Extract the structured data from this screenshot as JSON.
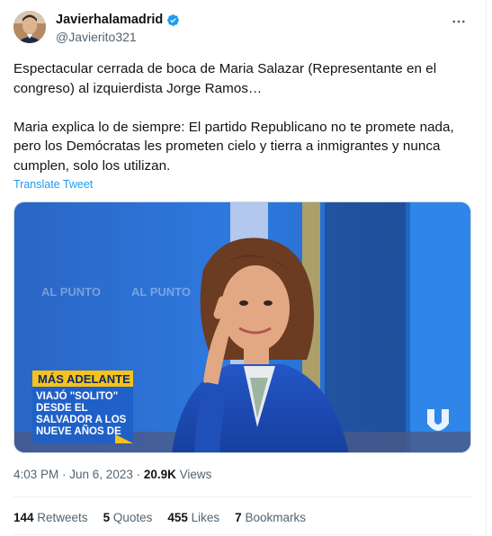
{
  "author": {
    "display_name": "Javierhalamadrid",
    "handle": "@Javierito321"
  },
  "tweet": {
    "text": "Espectacular cerrada de boca de Maria Salazar (Representante en el congreso) al izquierdista Jorge Ramos…\n\nMaria explica lo de siempre: El partido Republicano no te promete nada, pero los Demócratas les prometen cielo y tierra a inmigrantes y nunca cumplen, solo los utilizan.",
    "translate_label": "Translate Tweet"
  },
  "media": {
    "background_text_1": "AL PUNTO",
    "background_text_2": "AL PUNTO",
    "lower_third_header": "MÁS ADELANTE",
    "lower_third_line_1": "VIAJÓ \"SOLITO\"",
    "lower_third_line_2": "DESDE EL",
    "lower_third_line_3": "SALVADOR A LOS",
    "lower_third_line_4": "NUEVE AÑOS DE",
    "logo": "univision-logo"
  },
  "meta": {
    "time": "4:03 PM",
    "separator": " · ",
    "date": "Jun 6, 2023",
    "views_count": "20.9K",
    "views_label": " Views"
  },
  "stats": {
    "retweets_count": "144",
    "retweets_label": " Retweets",
    "quotes_count": "5",
    "quotes_label": " Quotes",
    "likes_count": "455",
    "likes_label": " Likes",
    "bookmarks_count": "7",
    "bookmarks_label": " Bookmarks"
  },
  "colors": {
    "link": "#1d9bf0",
    "verified": "#1d9bf0",
    "secondary_text": "#536471",
    "lower_third_yellow": "#f6c21b",
    "studio_blue": "#1f6fd1"
  },
  "icons": [
    "verified-badge-icon",
    "more-options-icon"
  ]
}
